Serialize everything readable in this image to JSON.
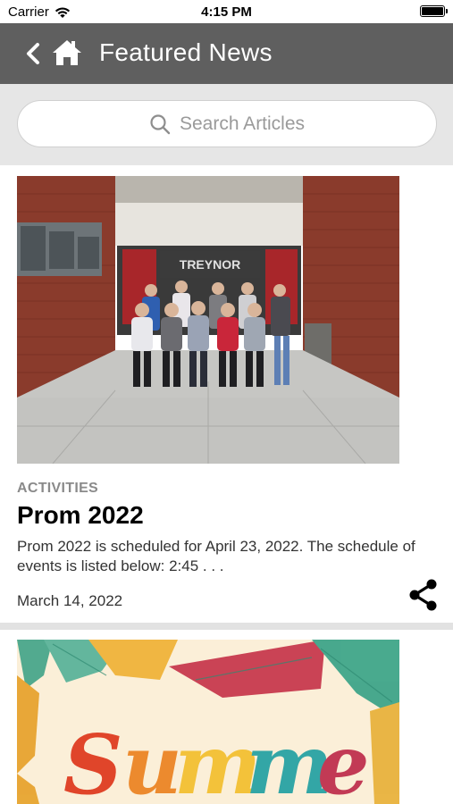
{
  "status_bar": {
    "carrier": "Carrier",
    "time": "4:15 PM"
  },
  "nav": {
    "title": "Featured News",
    "back_icon": "chevron-left-icon",
    "home_icon": "home-icon"
  },
  "search": {
    "placeholder": "Search Articles",
    "icon": "search-icon"
  },
  "articles": [
    {
      "category": "ACTIVITIES",
      "title": "Prom 2022",
      "excerpt": "Prom 2022 is scheduled for April 23, 2022. The schedule of events is listed below: 2:45 . . .",
      "date": "March 14, 2022",
      "share_icon": "share-icon",
      "sign_text": "TREYNOR"
    },
    {
      "image_text": "Summer"
    }
  ],
  "colors": {
    "nav_bg": "#5f5f5f",
    "search_bg": "#e6e6e6",
    "category": "#8a8a8a"
  }
}
